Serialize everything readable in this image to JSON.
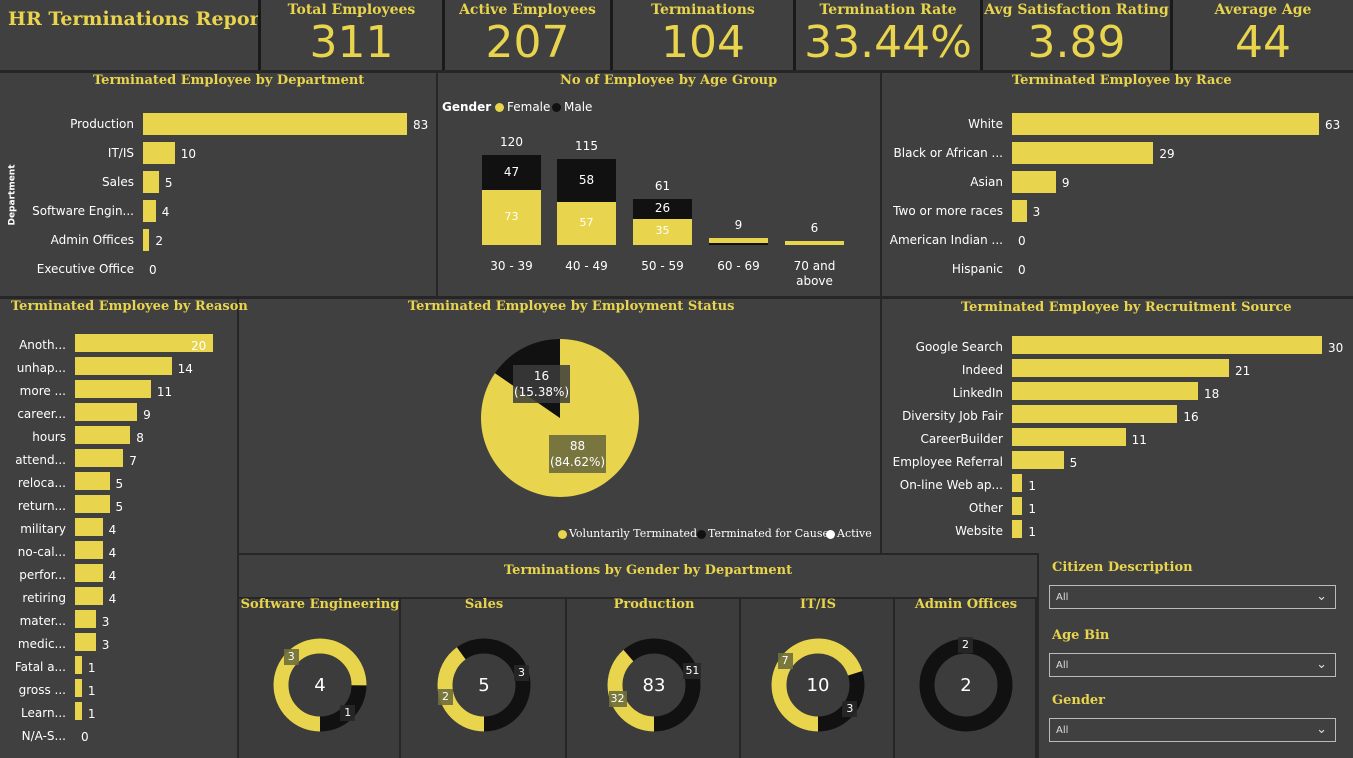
{
  "report_title": "HR Terminations Report",
  "kpis": [
    {
      "label": "Total Employees",
      "value": "311"
    },
    {
      "label": "Active Employees",
      "value": "207"
    },
    {
      "label": "Terminations",
      "value": "104"
    },
    {
      "label": "Termination Rate",
      "value": "33.44%"
    },
    {
      "label": "Avg Satisfaction Rating",
      "value": "3.89"
    },
    {
      "label": "Average Age",
      "value": "44"
    }
  ],
  "colors": {
    "accent": "#e8d44d",
    "background": "#404040",
    "dark": "#111111"
  },
  "chart_data": [
    {
      "type": "bar",
      "title": "Terminated Employee by Department",
      "ylabel": "Department",
      "categories": [
        "Production",
        "IT/IS",
        "Sales",
        "Software Engin...",
        "Admin Offices",
        "Executive Office"
      ],
      "values": [
        83,
        10,
        5,
        4,
        2,
        0
      ]
    },
    {
      "type": "bar",
      "title": "No of Employee by Age Group",
      "legend_title": "Gender",
      "categories": [
        "30 - 39",
        "40 - 49",
        "50 - 59",
        "60 - 69",
        "70 and above"
      ],
      "totals": [
        120,
        115,
        61,
        9,
        6
      ],
      "series": [
        {
          "name": "Female",
          "values": [
            73,
            57,
            35,
            9,
            6
          ]
        },
        {
          "name": "Male",
          "values": [
            47,
            58,
            26,
            0,
            0
          ]
        }
      ]
    },
    {
      "type": "bar",
      "title": "Terminated Employee by Race",
      "categories": [
        "White",
        "Black or African ...",
        "Asian",
        "Two or more races",
        "American Indian ...",
        "Hispanic"
      ],
      "values": [
        63,
        29,
        9,
        3,
        0,
        0
      ]
    },
    {
      "type": "bar",
      "title": "Terminated Employee by Reason",
      "categories": [
        "Anoth...",
        "unhap...",
        "more ...",
        "career...",
        "hours",
        "attend...",
        "reloca...",
        "return...",
        "military",
        "no-cal...",
        "perfor...",
        "retiring",
        "mater...",
        "medic...",
        "Fatal a...",
        "gross ...",
        "Learn...",
        "N/A-S..."
      ],
      "values": [
        20,
        14,
        11,
        9,
        8,
        7,
        5,
        5,
        4,
        4,
        4,
        4,
        3,
        3,
        1,
        1,
        1,
        0
      ]
    },
    {
      "type": "pie",
      "title": "Terminated Employee by Employment Status",
      "slices": [
        {
          "name": "Voluntarily Terminated",
          "value": 88,
          "label": "88",
          "pct": "(84.62%)"
        },
        {
          "name": "Terminated for Cause",
          "value": 16,
          "label": "16",
          "pct": "(15.38%)"
        },
        {
          "name": "Active",
          "value": 0
        }
      ]
    },
    {
      "type": "bar",
      "title": "Terminated Employee by Recruitment Source",
      "categories": [
        "Google Search",
        "Indeed",
        "LinkedIn",
        "Diversity Job Fair",
        "CareerBuilder",
        "Employee Referral",
        "On-line Web ap...",
        "Other",
        "Website"
      ],
      "values": [
        30,
        21,
        18,
        16,
        11,
        5,
        1,
        1,
        1
      ]
    },
    {
      "type": "pie",
      "title": "Terminations by Gender by Department",
      "donuts": [
        {
          "name": "Software Engineering",
          "total": "4",
          "female": 3,
          "male": 1
        },
        {
          "name": "Sales",
          "total": "5",
          "female": 2,
          "male": 3
        },
        {
          "name": "Production",
          "total": "83",
          "female": 32,
          "male": 51
        },
        {
          "name": "IT/IS",
          "total": "10",
          "female": 7,
          "male": 3
        },
        {
          "name": "Admin Offices",
          "total": "2",
          "female": 0,
          "male": 2
        }
      ]
    }
  ],
  "slicers": [
    {
      "title": "Citizen Description",
      "value": "All"
    },
    {
      "title": "Age Bin",
      "value": "All"
    },
    {
      "title": "Gender",
      "value": "All"
    }
  ]
}
